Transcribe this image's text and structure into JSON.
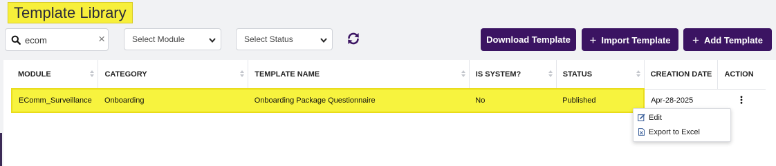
{
  "page": {
    "title": "Template Library"
  },
  "filters": {
    "search_value": "ecom",
    "search_clear": "×",
    "module_placeholder": "Select Module",
    "status_placeholder": "Select Status"
  },
  "toolbar": {
    "download_label": "Download Template",
    "import_label": "Import Template",
    "add_label": "Add Template",
    "plus_glyph": "+"
  },
  "table": {
    "headers": {
      "module": "MODULE",
      "category": "CATEGORY",
      "template_name": "TEMPLATE NAME",
      "is_system": "IS SYSTEM?",
      "status": "STATUS",
      "creation_date": "CREATION DATE",
      "action": "ACTION"
    },
    "rows": [
      {
        "module": "EComm_Surveillance",
        "category": "Onboarding",
        "template_name": "Onboarding Package Questionnaire",
        "is_system": "No",
        "status": "Published",
        "creation_date": "Apr-28-2025"
      }
    ]
  },
  "action_menu": {
    "edit_label": "Edit",
    "export_label": "Export to Excel"
  },
  "colors": {
    "brand": "#3b1462",
    "highlight": "#f7f33e",
    "background": "#f1f2f4"
  },
  "icons": {
    "search": "search-icon",
    "clear": "close-icon",
    "chevron": "chevron-down-icon",
    "refresh": "refresh-icon",
    "kebab": "kebab-menu-icon",
    "edit": "edit-icon",
    "export": "excel-file-icon"
  }
}
